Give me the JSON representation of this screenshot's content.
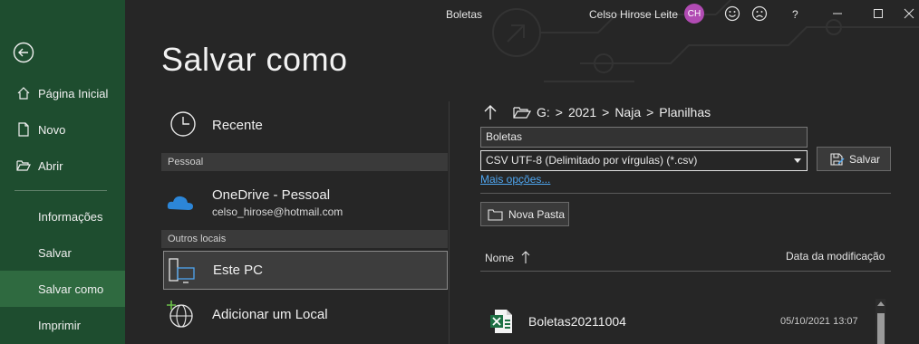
{
  "titlebar": {
    "doc_title": "Boletas",
    "user_name": "Celso Hirose Leite",
    "avatar_initials": "CH",
    "help": "?"
  },
  "sidebar": {
    "items": [
      {
        "label": "Página Inicial",
        "icon": "home-icon"
      },
      {
        "label": "Novo",
        "icon": "new-document-icon"
      },
      {
        "label": "Abrir",
        "icon": "open-folder-icon"
      },
      {
        "label": "Informações"
      },
      {
        "label": "Salvar"
      },
      {
        "label": "Salvar como"
      },
      {
        "label": "Imprimir"
      }
    ]
  },
  "page": {
    "title": "Salvar como"
  },
  "locations": {
    "recent_label": "Recente",
    "section_personal": "Pessoal",
    "onedrive_title": "OneDrive - Pessoal",
    "onedrive_email": "celso_hirose@hotmail.com",
    "section_other": "Outros locais",
    "this_pc": "Este PC",
    "add_location": "Adicionar um Local"
  },
  "save_panel": {
    "breadcrumb": [
      "G:",
      "2021",
      "Naja",
      "Planilhas"
    ],
    "breadcrumb_sep": ">",
    "filename": "Boletas",
    "file_type": "CSV UTF-8 (Delimitado por vírgulas) (*.csv)",
    "save_button": "Salvar",
    "more_options": "Mais opções...",
    "new_folder_button": "Nova Pasta",
    "column_name": "Nome",
    "column_modified": "Data da modificação"
  },
  "files": [
    {
      "name": "Boletas20211004",
      "modified": "05/10/2021 13:07",
      "icon": "excel-file-icon"
    }
  ],
  "colors": {
    "sidebar": "#1e4d2f",
    "sidebar_active": "#2f6a40",
    "background": "#262626",
    "link": "#4fa6f0",
    "avatar": "#b14bb3",
    "excel_green": "#1d7044"
  }
}
